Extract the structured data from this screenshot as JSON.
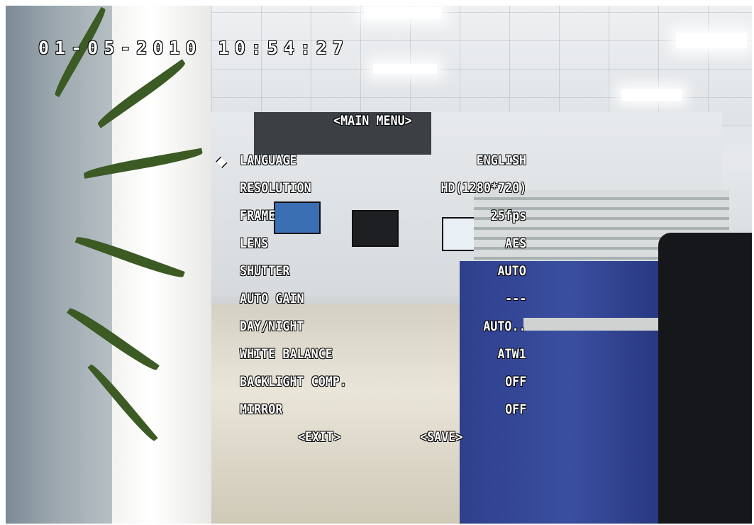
{
  "timestamp": "01-05-2010  10:54:27",
  "menu": {
    "title": "<MAIN MENU>",
    "cursor_icon": "diamond",
    "items": [
      {
        "label": "LANGUAGE",
        "value": "ENGLISH"
      },
      {
        "label": "RESOLUTION",
        "value": "HD(1280*720)"
      },
      {
        "label": "FRAME",
        "value": "25fps"
      },
      {
        "label": "LENS",
        "value": "AES"
      },
      {
        "label": "SHUTTER",
        "value": "AUTO"
      },
      {
        "label": "AUTO GAIN",
        "value": "---"
      },
      {
        "label": "DAY/NIGHT",
        "value": "AUTO.."
      },
      {
        "label": "WHITE BALANCE",
        "value": "ATW1"
      },
      {
        "label": "BACKLIGHT COMP.",
        "value": "OFF"
      },
      {
        "label": "MIRROR",
        "value": "OFF"
      }
    ],
    "exit_label": "<EXIT>",
    "save_label": "<SAVE>"
  },
  "colors": {
    "osd_text": "#ffffff",
    "osd_outline": "#000000"
  }
}
